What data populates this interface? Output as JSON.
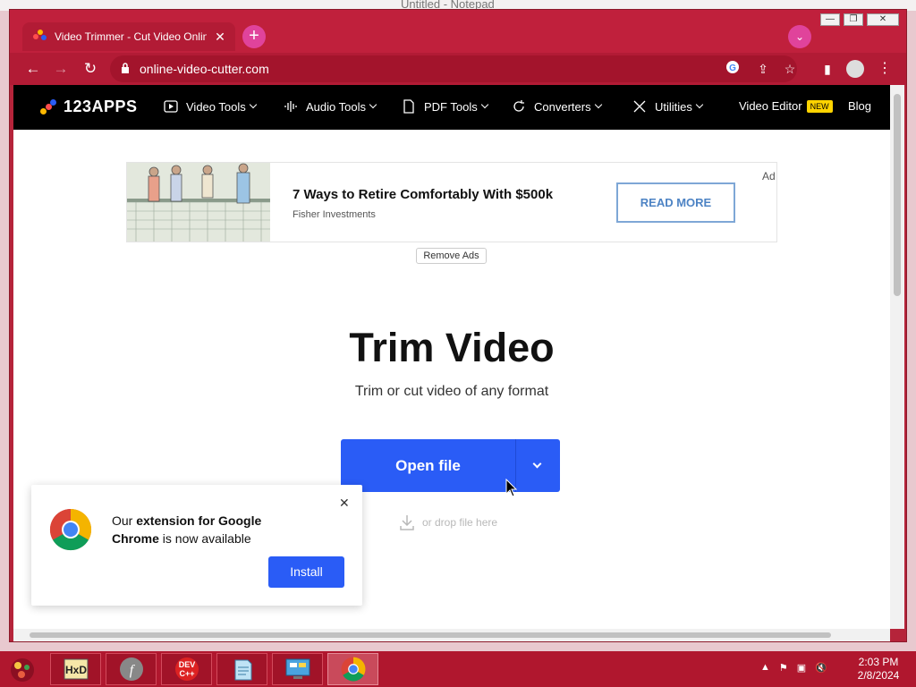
{
  "background_window": {
    "title": "Untitled - Notepad"
  },
  "browser": {
    "tab": {
      "title": "Video Trimmer - Cut Video Onlin"
    },
    "address": {
      "url": "online-video-cutter.com"
    },
    "accent_color": "#b21b35"
  },
  "site": {
    "logo": "123APPS",
    "nav": {
      "video_tools": "Video Tools",
      "audio_tools": "Audio Tools",
      "pdf_tools": "PDF Tools",
      "converters": "Converters",
      "utilities": "Utilities",
      "video_editor": "Video Editor",
      "new_badge": "NEW",
      "blog": "Blog"
    },
    "ad": {
      "title": "7 Ways to Retire Comfortably With $500k",
      "sponsor": "Fisher Investments",
      "button": "READ MORE",
      "label": "Ad",
      "remove": "Remove Ads"
    },
    "hero": {
      "title": "Trim Video",
      "subtitle": "Trim or cut video of any format",
      "open_button": "Open file",
      "drop_text": "or drop file here"
    },
    "popup": {
      "text_before": "Our ",
      "text_bold": "extension for Google Chrome",
      "text_after": " is now available",
      "install": "Install"
    },
    "primary_color": "#2a5cf6"
  },
  "taskbar": {
    "time": "2:03 PM",
    "date": "2/8/2024",
    "apps": [
      "hxd",
      "flash",
      "dev-cpp",
      "notepad",
      "control-panel",
      "chrome"
    ],
    "dev_label": "DEV\nC++"
  }
}
